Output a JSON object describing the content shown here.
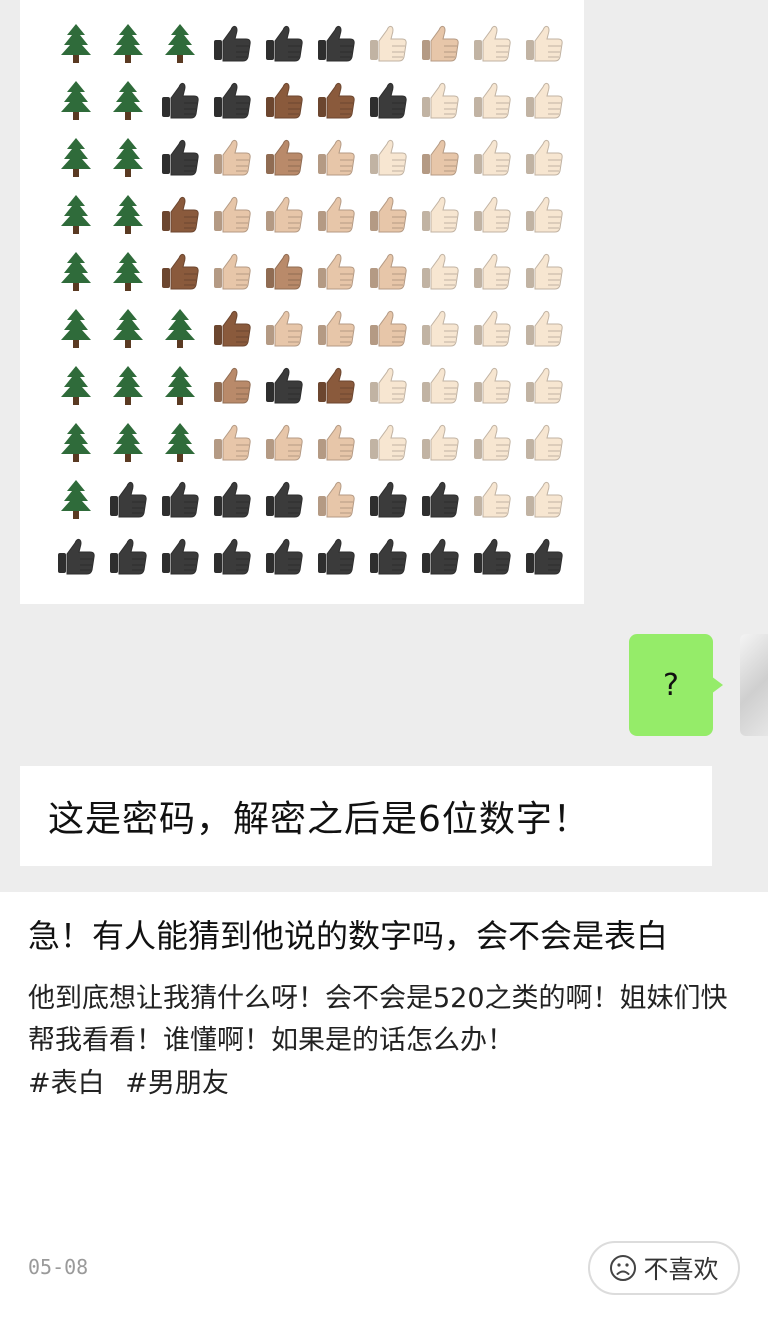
{
  "chat": {
    "image_grid": {
      "rows": [
        [
          "tree",
          "tree",
          "tree",
          "dark",
          "dark",
          "dark",
          "pale",
          "light",
          "pale",
          "pale"
        ],
        [
          "tree",
          "tree",
          "dark",
          "dark",
          "brown",
          "brown",
          "dark",
          "pale",
          "pale",
          "pale"
        ],
        [
          "tree",
          "tree",
          "dark",
          "light",
          "medium",
          "light",
          "pale",
          "light",
          "pale",
          "pale"
        ],
        [
          "tree",
          "tree",
          "brown",
          "light",
          "light",
          "light",
          "light",
          "pale",
          "pale",
          "pale"
        ],
        [
          "tree",
          "tree",
          "brown",
          "light",
          "medium",
          "light",
          "light",
          "pale",
          "pale",
          "pale"
        ],
        [
          "tree",
          "tree",
          "tree",
          "brown",
          "light",
          "light",
          "light",
          "pale",
          "pale",
          "pale"
        ],
        [
          "tree",
          "tree",
          "tree",
          "medium",
          "dark",
          "brown",
          "pale",
          "pale",
          "pale",
          "pale"
        ],
        [
          "tree",
          "tree",
          "tree",
          "light",
          "light",
          "light",
          "pale",
          "pale",
          "pale",
          "pale"
        ],
        [
          "tree",
          "dark",
          "dark",
          "dark",
          "dark",
          "light",
          "dark",
          "dark",
          "pale",
          "pale"
        ],
        [
          "dark",
          "dark",
          "dark",
          "dark",
          "dark",
          "dark",
          "dark",
          "dark",
          "dark",
          "dark"
        ]
      ],
      "icon_names": {
        "tree": "evergreen-tree-icon",
        "thumb": "thumbs-up-icon"
      },
      "colors": {
        "dark": "#3b3b3b",
        "brown": "#8a5a3c",
        "medium": "#b98a6a",
        "light": "#e7c6a9",
        "pale": "#f7e6d1",
        "tree_fill": "#2f6b3a",
        "tree_trunk": "#5a3a22"
      }
    },
    "sent_message": "?",
    "received_message": "这是密码，解密之后是6位数字！",
    "colors": {
      "background": "#ededed",
      "sent_bubble": "#95ec69",
      "received_bubble": "#ffffff"
    }
  },
  "post": {
    "title": "急！有人能猜到他说的数字吗，会不会是表白",
    "body": "他到底想让我猜什么呀！会不会是520之类的啊！姐妹们快帮我看看！谁懂啊！如果是的话怎么办！",
    "tags": [
      "#表白",
      "#男朋友"
    ],
    "date": "05-08",
    "dislike_label": "不喜欢",
    "dislike_icon": "sad-face-icon"
  }
}
